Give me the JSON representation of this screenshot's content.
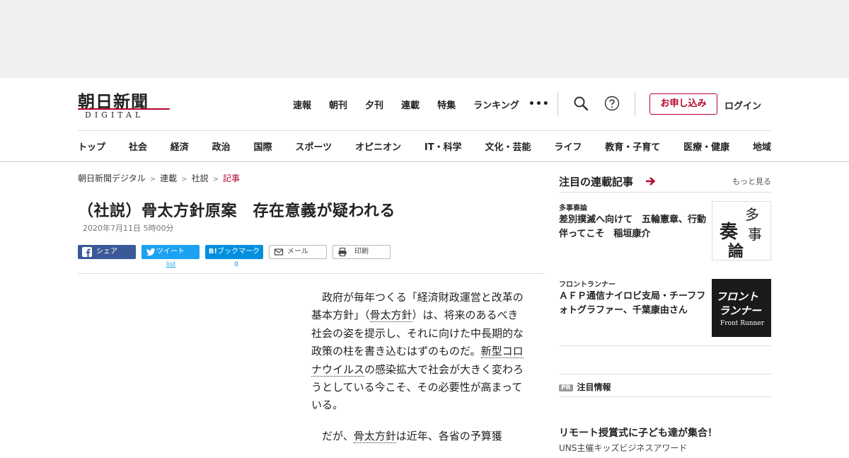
{
  "logo": {
    "jp": "朝日新聞",
    "en": "DIGITAL"
  },
  "top_nav": [
    "速報",
    "朝刊",
    "夕刊",
    "連載",
    "特集",
    "ランキング"
  ],
  "more_label": "•••",
  "signup_label": "お申し込み",
  "login_label": "ログイン",
  "category_nav": [
    "トップ",
    "社会",
    "経済",
    "政治",
    "国際",
    "スポーツ",
    "オピニオン",
    "IT・科学",
    "文化・芸能",
    "ライフ",
    "教育・子育て",
    "医療・健康",
    "地域"
  ],
  "breadcrumb": [
    "朝日新聞デジタル",
    "連載",
    "社説",
    "記事"
  ],
  "breadcrumb_sep": ">",
  "article": {
    "title": "（社説）骨太方針原案　存在意義が疑われる",
    "date": "2020年7月11日 5時00分",
    "para1": {
      "a": "政府が毎年つくる「経済財政運営と改革の基本方針」（",
      "kw1": "骨太方針",
      "b": "）は、将来のあるべき社会の姿を提示し、それに向けた中長期的な政策の柱を書き込むはずのものだ。",
      "kw2": "新型コロナウイルス",
      "c": "の感染拡大で社会が大きく変わろうとしている今こそ、その必要性が高まっている。"
    },
    "para2": {
      "a": "だが、",
      "kw1": "骨太方針",
      "b": "は近年、各省の予算獲"
    }
  },
  "share": {
    "facebook": "シェア",
    "twitter": "ツイート",
    "hatena": "ブックマーク",
    "hatena_prefix": "B!",
    "mail": "メール",
    "print": "印刷",
    "twitter_count": "list",
    "hatena_count": "0"
  },
  "rail": {
    "heading": "注目の連載記事",
    "more": "もっと見る",
    "items": [
      {
        "category": "多事奏論",
        "title": "差別撲滅へ向けて　五輪憲章、行動伴ってこそ　稲垣康介",
        "thumb_chars": [
          "多",
          "事",
          "奏",
          "論"
        ]
      },
      {
        "category": "フロントランナー",
        "title": "ＡＦＰ通信ナイロビ支局・チーフフォトグラファー、千葉康由さん",
        "thumb_jp1": "フロント",
        "thumb_jp2": "ランナー",
        "thumb_en": "Front Runner"
      }
    ],
    "pr_badge": "PR",
    "pr_heading": "注目情報",
    "pr_title": "リモート授賞式に子ども達が集合！",
    "pr_sub": "UNS主催キッズビジネスアワード"
  },
  "colors": {
    "brand_red": "#b3062c",
    "facebook": "#3b5998",
    "twitter": "#1da1f2",
    "hatena": "#008fde"
  }
}
